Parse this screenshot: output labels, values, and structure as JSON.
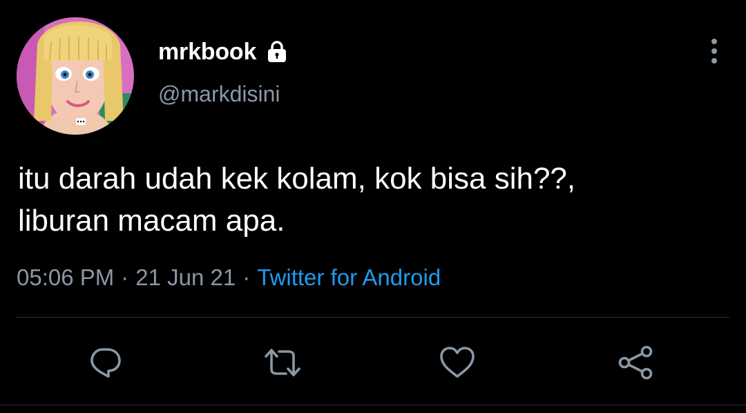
{
  "tweet": {
    "author": {
      "display_name": "mrkbook",
      "handle": "@markdisini",
      "protected_icon": "lock-icon",
      "avatar": "cartoon-doll-avatar"
    },
    "text_lines": [
      "itu darah udah kek kolam, kok bisa sih??,",
      "liburan macam apa."
    ],
    "meta": {
      "time": "05:06 PM",
      "separator": "·",
      "date": "21 Jun 21",
      "source": "Twitter for Android"
    },
    "actions": {
      "reply": "reply-icon",
      "retweet": "retweet-icon",
      "like": "heart-icon",
      "share": "share-icon",
      "more": "more-vertical-icon"
    }
  },
  "colors": {
    "background": "#000000",
    "primary_text": "#ffffff",
    "secondary_text": "#8b98a5",
    "link": "#1d9bf0",
    "divider": "#2f3336",
    "icon": "#8b98a5"
  }
}
